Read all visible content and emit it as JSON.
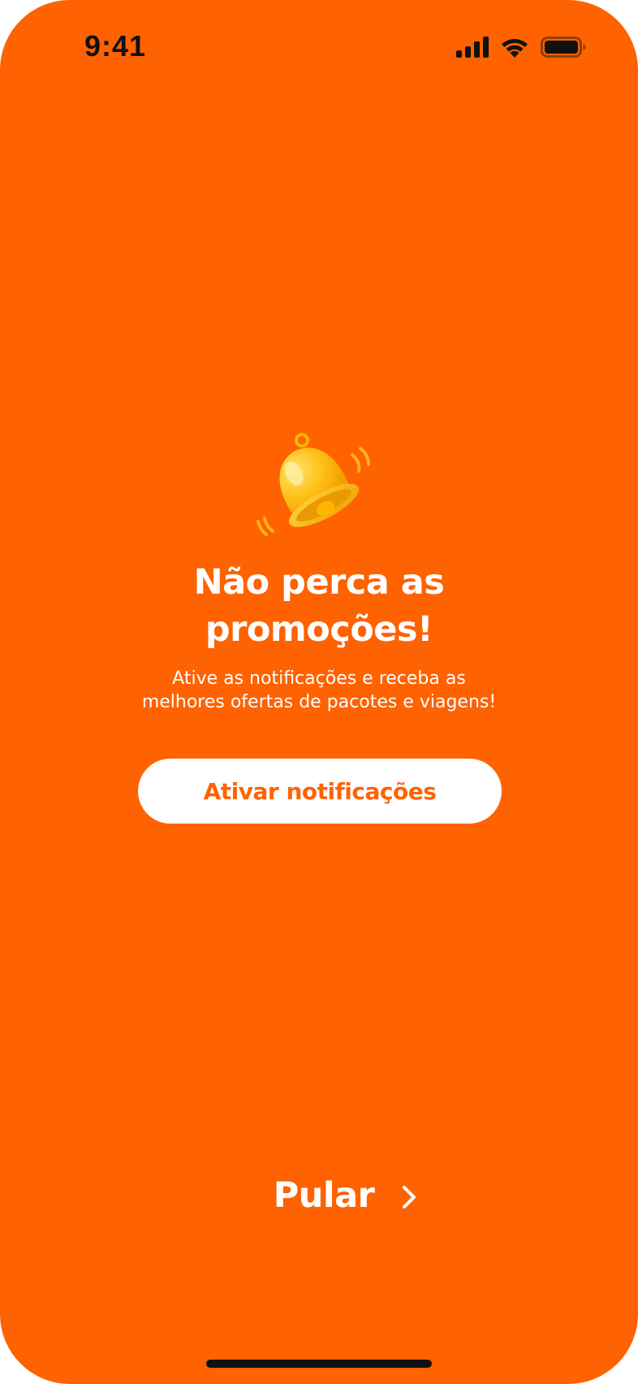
{
  "status_bar": {
    "time": "9:41",
    "icons": [
      "cellular-signal-icon",
      "wifi-icon",
      "battery-icon"
    ]
  },
  "illustration": {
    "icon": "bell-icon"
  },
  "promo": {
    "title_line1": "Não perca as",
    "title_line2": "promoções!",
    "subtitle_line1": "Ative as notificações e receba as",
    "subtitle_line2": "melhores ofertas de pacotes e viagens!"
  },
  "actions": {
    "enable_notifications_label": "Ativar notificações",
    "skip_label": "Pular"
  },
  "colors": {
    "background": "#FF6200",
    "button_background": "#FFFFFF",
    "button_text": "#FF6200",
    "text": "#FFFFFF",
    "status_bar": "#111111",
    "bell": "#FFC21A"
  }
}
